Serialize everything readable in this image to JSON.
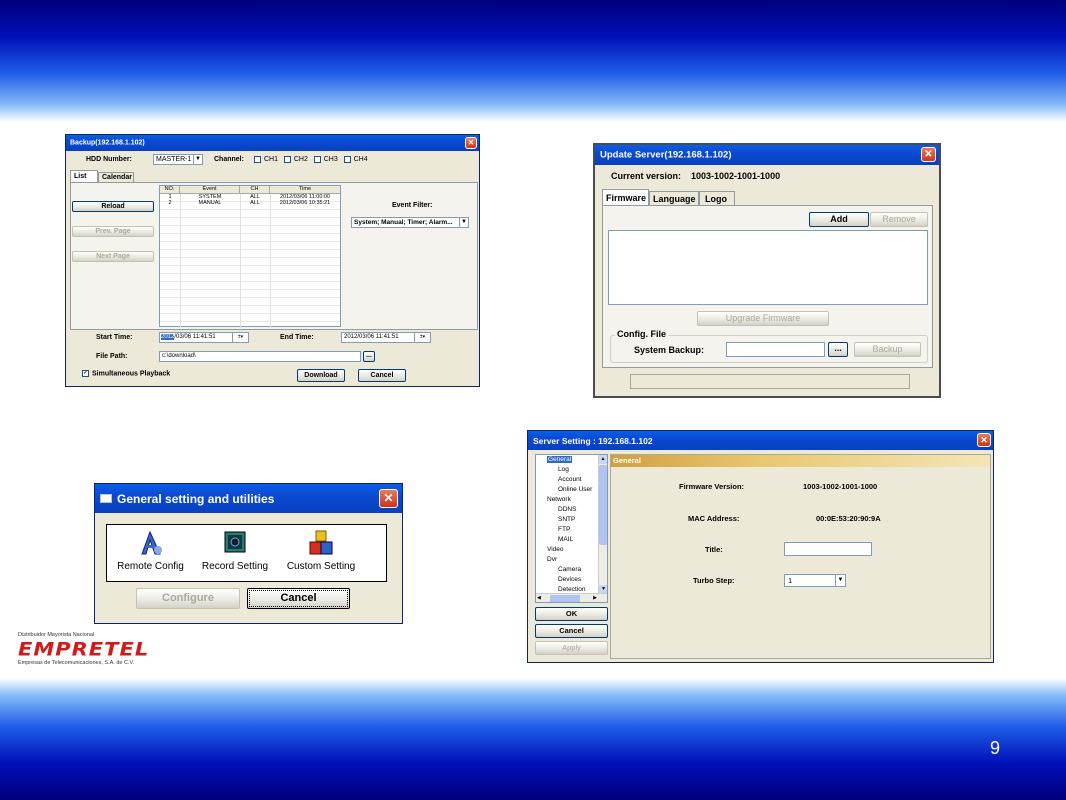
{
  "slide": {
    "page_number": "9"
  },
  "backup": {
    "title": "Backup(192.168.1.102)",
    "hdd_label": "HDD Number:",
    "hdd_value": "MASTER-1",
    "channel_label": "Channel:",
    "channels": [
      "CH1",
      "CH2",
      "CH3",
      "CH4"
    ],
    "tabs": [
      "List",
      "Calendar"
    ],
    "reload": "Reload",
    "prev_page": "Prev. Page",
    "next_page": "Next Page",
    "table_headers": [
      "NO.",
      "Event",
      "CH",
      "Time"
    ],
    "rows": [
      [
        "1",
        "SYSTEM",
        "ALL",
        "2012/03/06 11:00:00"
      ],
      [
        "2",
        "MANUAL",
        "ALL",
        "2012/03/06 10:35:21"
      ]
    ],
    "event_filter_label": "Event Filter:",
    "event_filter_value": "System; Manual; Timer; Alarm...",
    "start_time_label": "Start Time:",
    "start_year": "2012",
    "start_time_rest": "/03/06 11:41:51",
    "end_time_label": "End Time:",
    "end_time_value": "2012/03/06 11:41:51",
    "file_path_label": "File Path:",
    "file_path_value": "c:\\download\\",
    "browse": "...",
    "simultaneous": "Simultaneous Playback",
    "download": "Download",
    "cancel": "Cancel"
  },
  "update": {
    "title": "Update Server(192.168.1.102)",
    "current_version_label": "Current version:",
    "current_version": "1003-1002-1001-1000",
    "tabs": [
      "Firmware",
      "Language",
      "Logo"
    ],
    "add": "Add",
    "remove": "Remove",
    "upgrade": "Upgrade Firmware",
    "config_group": "Config. File",
    "system_backup_label": "System Backup:",
    "browse": "...",
    "backup": "Backup"
  },
  "general_util": {
    "title": "General setting and utilities",
    "items": [
      "Remote Config",
      "Record Setting",
      "Custom Setting"
    ],
    "configure": "Configure",
    "cancel": "Cancel"
  },
  "logo": {
    "top_text": "Distribuidor Mayorista Nacional",
    "brand": "EMPRETEL",
    "bottom_text": "Empresas de Telecomunicaciones, S.A. de C.V."
  },
  "server": {
    "title": "Server Setting : 192.168.1.102",
    "tree": [
      "General",
      "Log",
      "Account",
      "Online User",
      "Network",
      "DDNS",
      "SNTP",
      "FTP",
      "MAIL",
      "Video",
      "Dvr",
      "Camera",
      "Devices",
      "Detection"
    ],
    "section": "General",
    "firmware_label": "Firmware Version:",
    "firmware_value": "1003-1002-1001-1000",
    "mac_label": "MAC Address:",
    "mac_value": "00:0E:53:20:90:9A",
    "title_label": "Title:",
    "title_value": "",
    "turbo_label": "Turbo Step:",
    "turbo_value": "1",
    "ok": "OK",
    "cancel": "Cancel",
    "apply": "Apply"
  }
}
